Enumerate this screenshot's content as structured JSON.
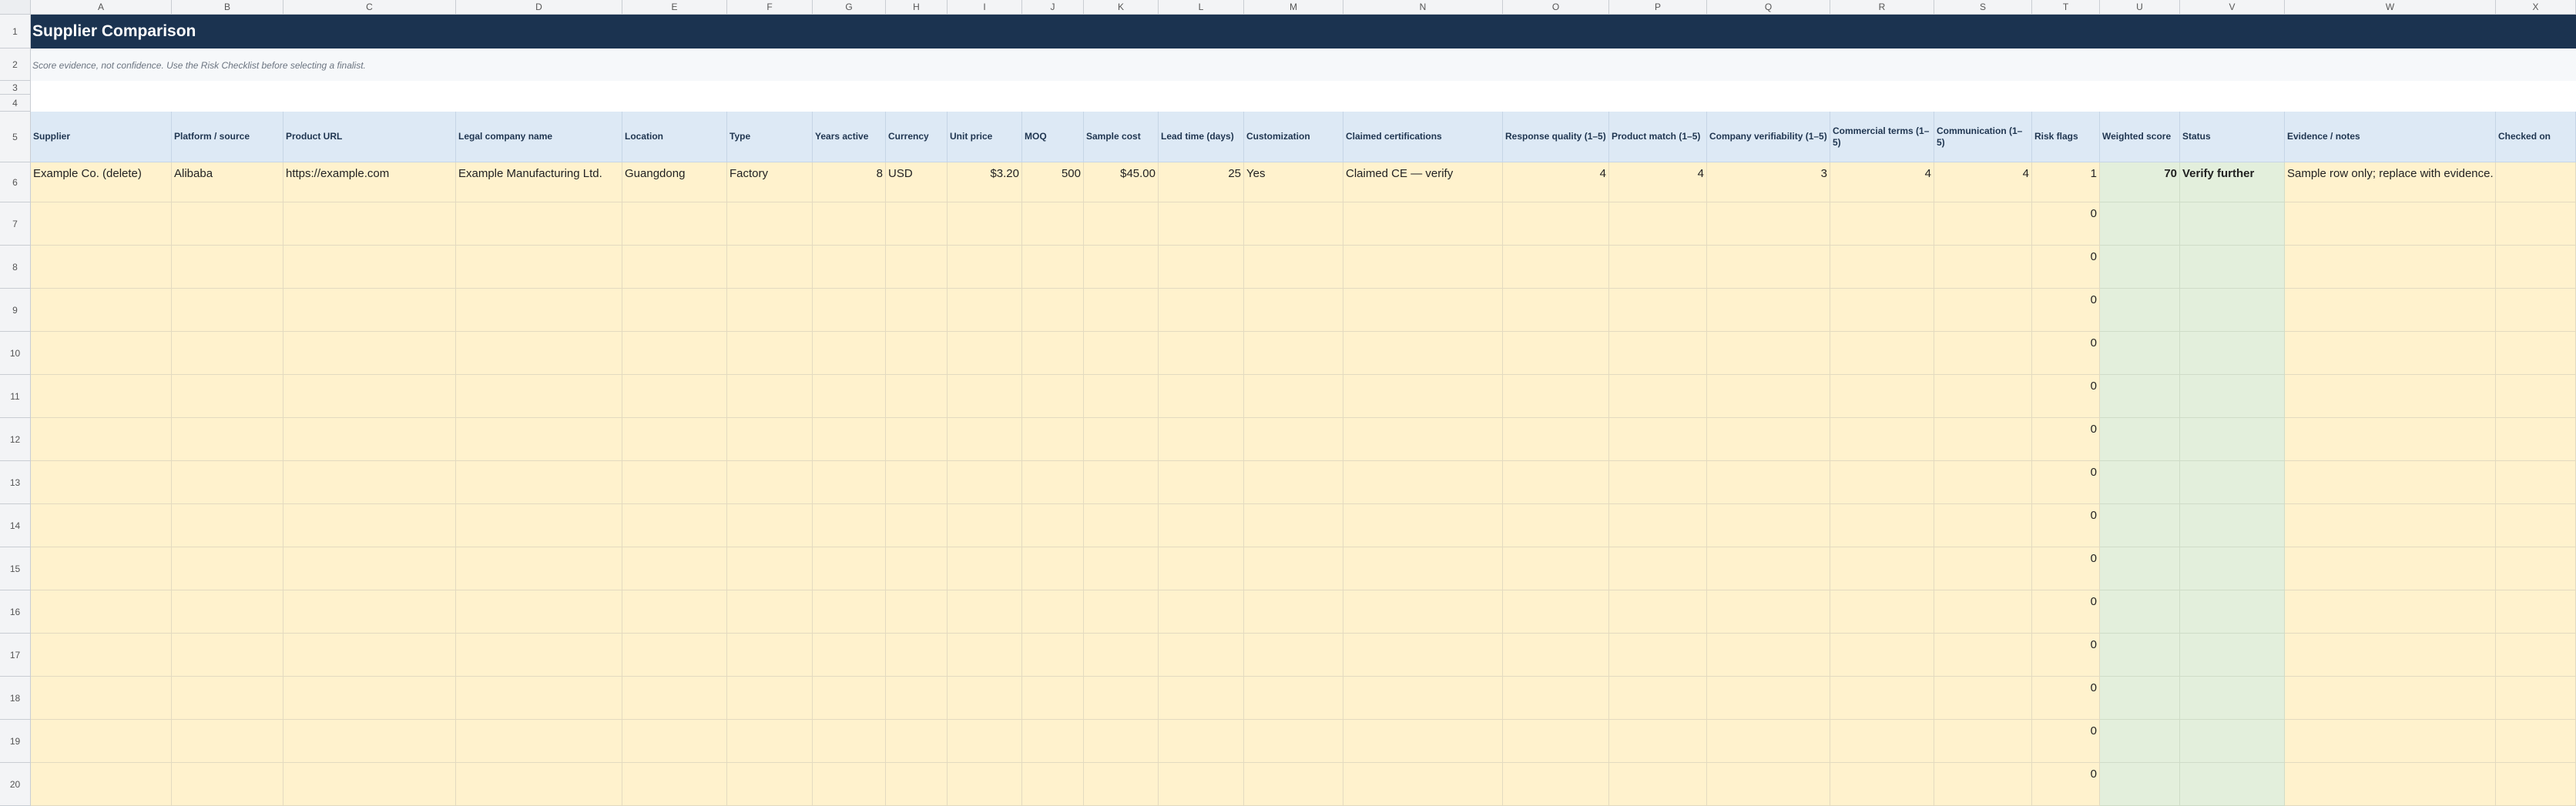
{
  "columns": [
    "A",
    "B",
    "C",
    "D",
    "E",
    "F",
    "G",
    "H",
    "I",
    "J",
    "K",
    "L",
    "M",
    "N",
    "O",
    "P",
    "Q",
    "R",
    "S",
    "T",
    "U",
    "V",
    "W",
    "X"
  ],
  "row_numbers": [
    "1",
    "2",
    "3",
    "4",
    "5",
    "6",
    "7",
    "8",
    "9",
    "10",
    "11",
    "12",
    "13",
    "14",
    "15",
    "16",
    "17",
    "18",
    "19",
    "20"
  ],
  "title": "Supplier Comparison",
  "subtitle": "Score evidence, not confidence. Use the Risk Checklist before selecting a finalist.",
  "headers": [
    "Supplier",
    "Platform / source",
    "Product URL",
    "Legal company name",
    "Location",
    "Type",
    "Years active",
    "Currency",
    "Unit price",
    "MOQ",
    "Sample cost",
    "Lead time (days)",
    "Customization",
    "Claimed certifications",
    "Response quality (1–5)",
    "Product match (1–5)",
    "Company verifiability (1–5)",
    "Commercial terms (1–5)",
    "Communication (1–5)",
    "Risk flags",
    "Weighted score",
    "Status",
    "Evidence / notes",
    "Checked on"
  ],
  "sample_row": [
    "Example Co. (delete)",
    "Alibaba",
    "https://example.com",
    "Example Manufacturing Ltd.",
    "Guangdong",
    "Factory",
    "8",
    "USD",
    "$3.20",
    "500",
    "$45.00",
    "25",
    "Yes",
    "Claimed CE — verify",
    "4",
    "4",
    "3",
    "4",
    "4",
    "1",
    "70",
    "Verify further",
    "Sample row only; replace with evidence.",
    ""
  ],
  "empty_weighted_score": "0",
  "colors": {
    "title_bg": "#1b3350",
    "header_bg": "#dde9f5",
    "input_bg": "#fff2cd",
    "calc_bg": "#e3efdc"
  }
}
